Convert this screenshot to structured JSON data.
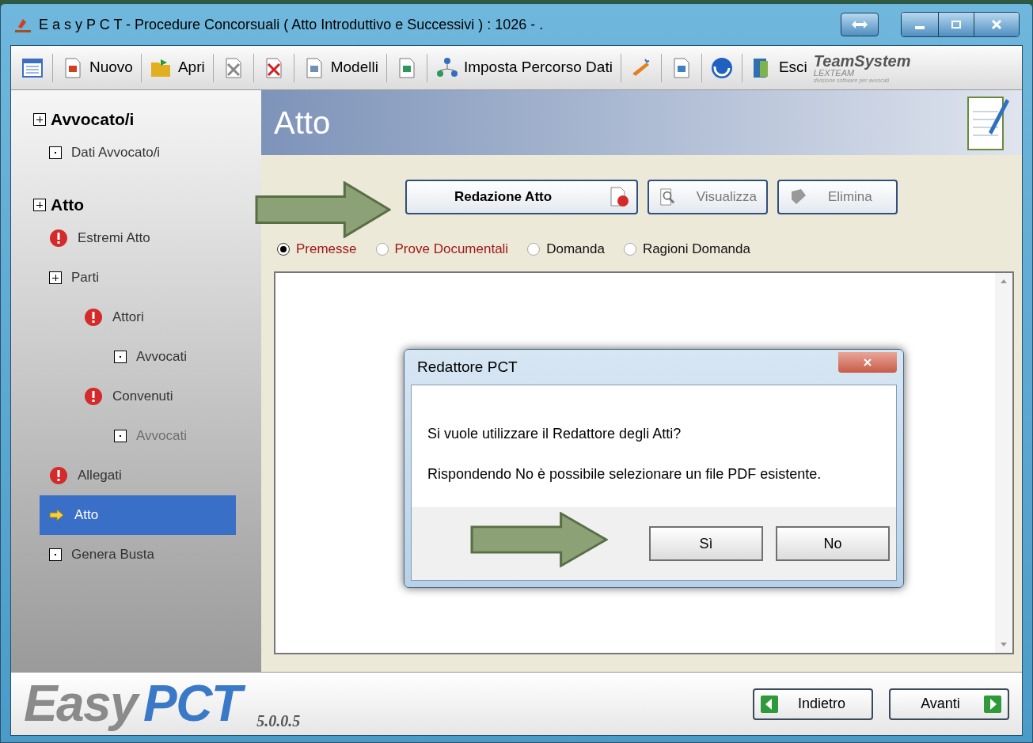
{
  "window": {
    "title": "E a s y P C T - Procedure Concorsuali ( Atto Introduttivo e Successivi ) :  1026 - ."
  },
  "toolbar": {
    "items": [
      {
        "kind": "icon"
      },
      {
        "kind": "button",
        "label": "Nuovo"
      },
      {
        "kind": "button",
        "label": "Apri"
      },
      {
        "kind": "icon"
      },
      {
        "kind": "icon"
      },
      {
        "kind": "button",
        "label": "Modelli"
      },
      {
        "kind": "icon"
      },
      {
        "kind": "button",
        "label": "Imposta Percorso Dati"
      },
      {
        "kind": "icon"
      },
      {
        "kind": "icon"
      },
      {
        "kind": "icon"
      },
      {
        "kind": "button",
        "label": "Esci"
      }
    ],
    "brand": {
      "name": "TeamSystem",
      "product": "LEXTEAM",
      "tagline": "divisione software per avvocati"
    }
  },
  "sidebar": {
    "groups": [
      {
        "title": "Avvocato/i",
        "children": [
          {
            "label": "Dati Avvocato/i",
            "kind": "leaf",
            "selected": false,
            "disabled": false
          }
        ]
      },
      {
        "title": "Atto",
        "children": [
          {
            "label": "Estremi Atto",
            "kind": "alert",
            "selected": false,
            "disabled": false
          },
          {
            "label": "Parti",
            "kind": "expand",
            "selected": false,
            "disabled": false,
            "children": [
              {
                "label": "Attori",
                "kind": "alert",
                "selected": false,
                "disabled": false,
                "children": [
                  {
                    "label": "Avvocati",
                    "kind": "leaf",
                    "selected": false,
                    "disabled": false
                  }
                ]
              },
              {
                "label": "Convenuti",
                "kind": "alert",
                "selected": false,
                "disabled": false,
                "children": [
                  {
                    "label": "Avvocati",
                    "kind": "leaf",
                    "selected": false,
                    "disabled": true
                  }
                ]
              }
            ]
          },
          {
            "label": "Allegati",
            "kind": "alert",
            "selected": false,
            "disabled": false
          },
          {
            "label": "Atto",
            "kind": "current",
            "selected": true,
            "disabled": false
          },
          {
            "label": "Genera Busta",
            "kind": "leaf",
            "selected": false,
            "disabled": false
          }
        ]
      }
    ]
  },
  "main": {
    "heading": "Atto",
    "buttons": [
      {
        "label": "Redazione Atto",
        "kind": "primary"
      },
      {
        "label": "Visualizza",
        "kind": "normal"
      },
      {
        "label": "Elimina",
        "kind": "normal"
      }
    ],
    "sections": [
      {
        "label": "Premesse",
        "selected": true,
        "color": "#a01818"
      },
      {
        "label": "Prove Documentali",
        "selected": false,
        "color": "#a01818"
      },
      {
        "label": "Domanda",
        "selected": false,
        "color": "#111111"
      },
      {
        "label": "Ragioni Domanda",
        "selected": false,
        "color": "#111111"
      }
    ]
  },
  "dialog": {
    "title": "Redattore PCT",
    "lines": [
      "Si vuole utilizzare il Redattore degli Atti?",
      "Rispondendo No è possibile selezionare un file PDF esistente."
    ],
    "buttons": [
      "Sì",
      "No"
    ]
  },
  "footer": {
    "logo_gray": "Easy",
    "logo_blue": "PCT",
    "version": "5.0.0.5",
    "nav": [
      {
        "label": "Indietro"
      },
      {
        "label": "Avanti"
      }
    ]
  }
}
